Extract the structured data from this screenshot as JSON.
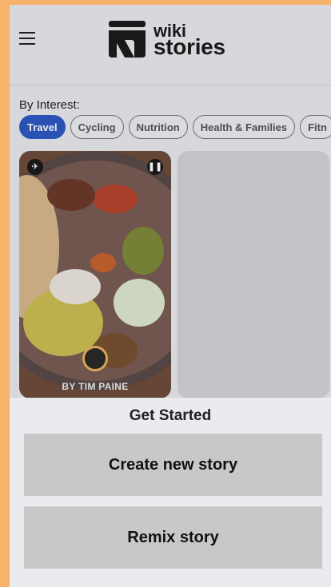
{
  "header": {
    "logo_top": "wiki",
    "logo_bottom": "stories"
  },
  "filters": {
    "label": "By Interest:",
    "chips": [
      {
        "label": "Travel",
        "active": true
      },
      {
        "label": "Cycling",
        "active": false
      },
      {
        "label": "Nutrition",
        "active": false
      },
      {
        "label": "Health & Families",
        "active": false
      },
      {
        "label": "Fitn",
        "active": false
      }
    ]
  },
  "story_card": {
    "byline": "BY TIM PAINE",
    "icons": [
      "no-flight-icon",
      "pause-icon"
    ]
  },
  "sheet": {
    "title": "Get Started",
    "create_label": "Create new story",
    "remix_label": "Remix story"
  },
  "colors": {
    "accent": "#2e59c4",
    "page_border": "#f7b26b",
    "sheet_button": "#c8c8c8"
  }
}
